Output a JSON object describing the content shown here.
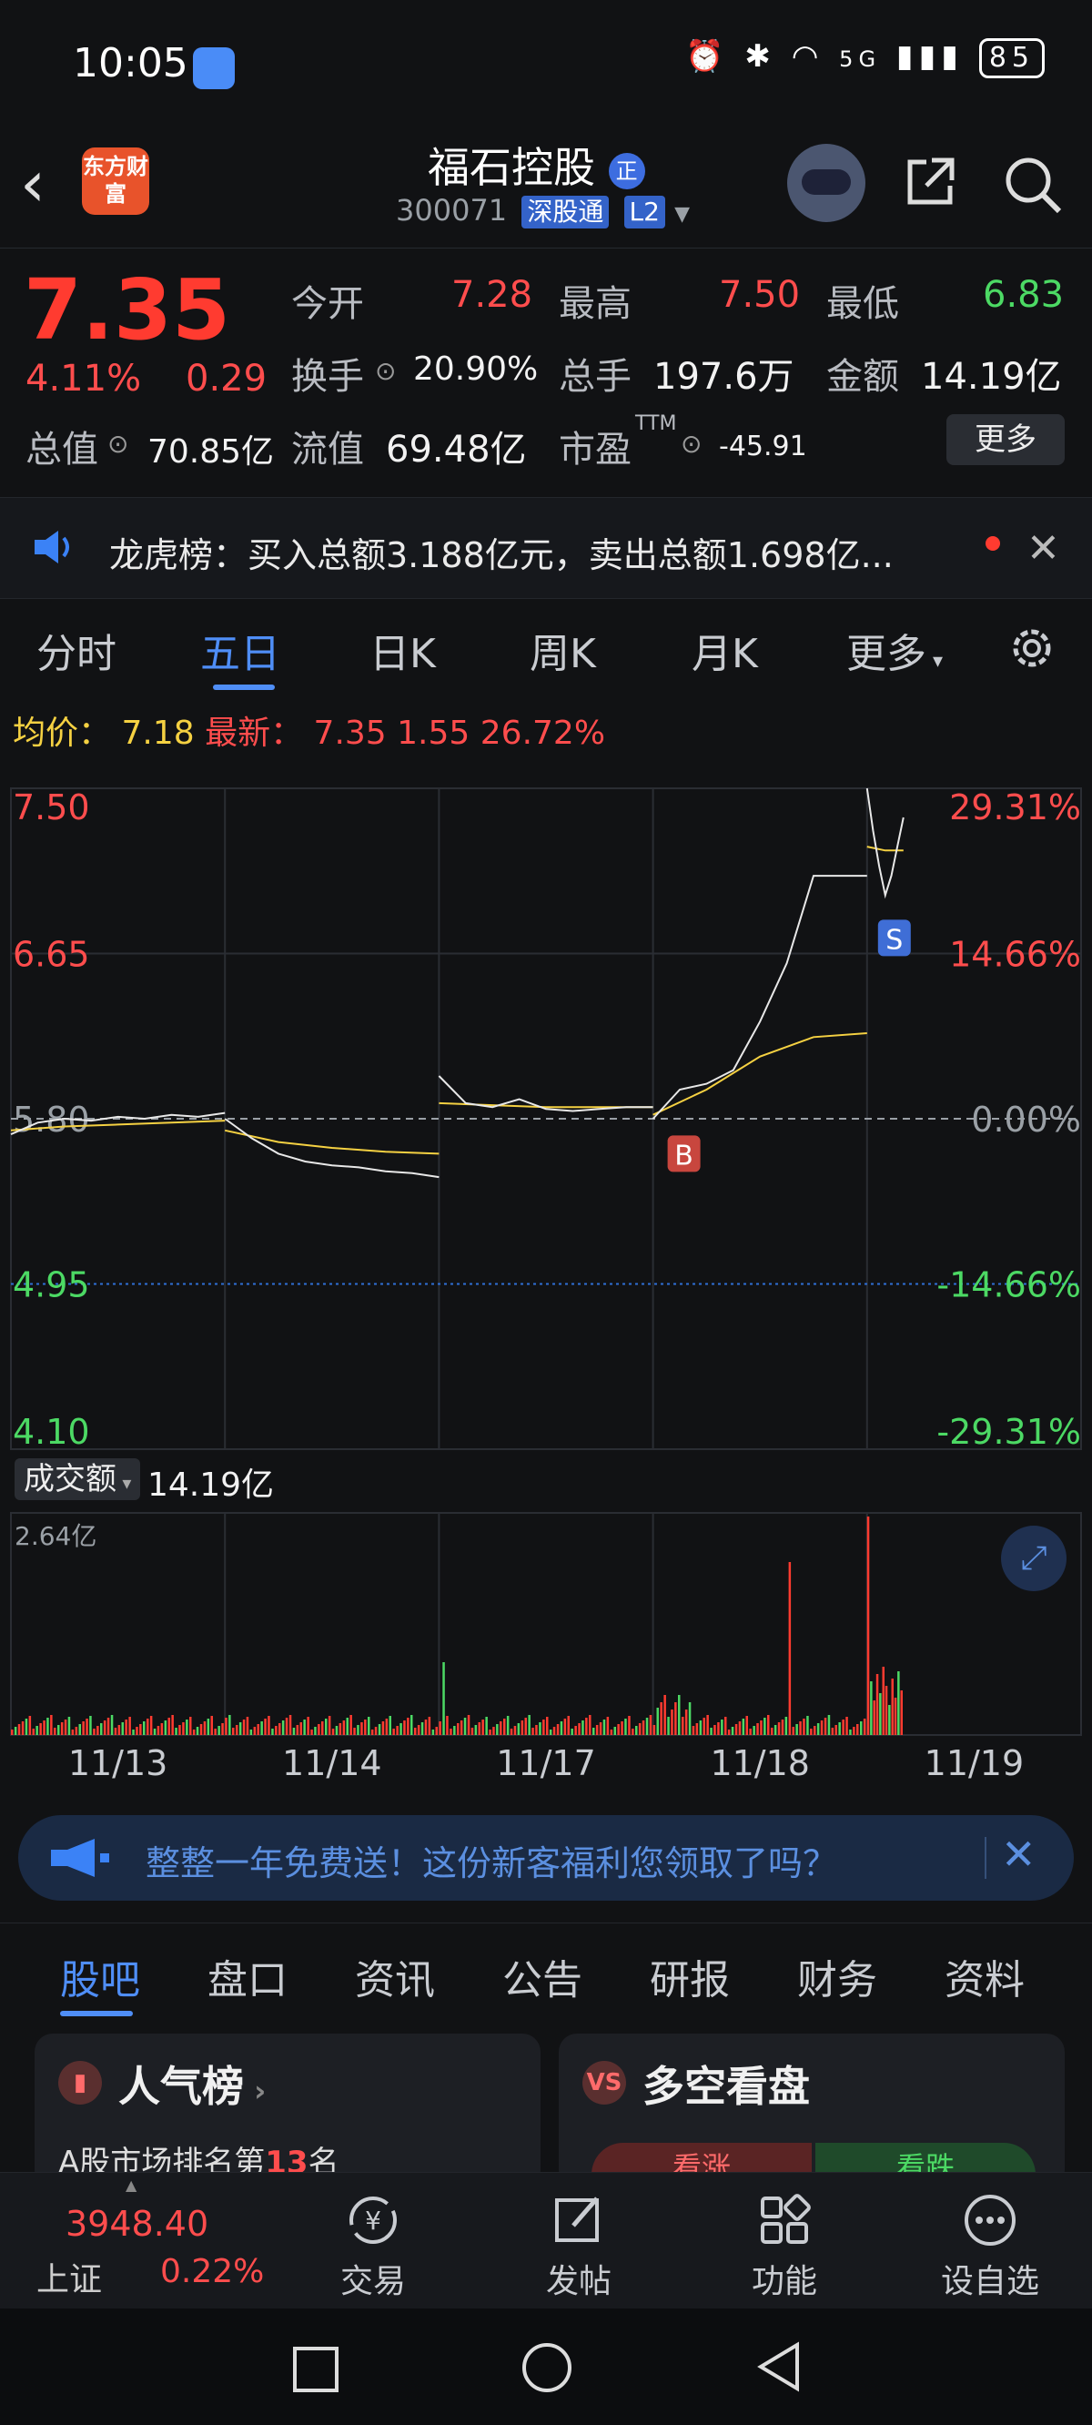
{
  "status_bar": {
    "time": "10:05",
    "network": "5G",
    "battery": "85"
  },
  "header": {
    "app_logo_text": "东方财富",
    "stock_name": "福石控股",
    "badge": "正",
    "code": "300071",
    "tag_connect": "深股通",
    "tag_level": "L2"
  },
  "quote": {
    "price": "7.35",
    "change_pct": "4.11%",
    "change": "0.29",
    "open_label": "今开",
    "open": "7.28",
    "high_label": "最高",
    "high": "7.50",
    "low_label": "最低",
    "low": "6.83",
    "turnover_label": "换手",
    "turnover": "20.90%",
    "volume_label": "总手",
    "volume": "197.6万",
    "amount_label": "金额",
    "amount": "14.19亿",
    "mktcap_label": "总值",
    "mktcap": "70.85亿",
    "float_label": "流值",
    "float_cap": "69.48亿",
    "pe_label": "市盈",
    "pe_sup": "TTM",
    "pe": "-45.91",
    "more_button": "更多"
  },
  "dragon_banner": {
    "text": "龙虎榜：买入总额3.188亿元，卖出总额1.698亿..."
  },
  "chart_tabs": [
    "分时",
    "五日",
    "日K",
    "周K",
    "月K",
    "更多"
  ],
  "chart_tabs_active": 1,
  "info_line": {
    "avg_label": "均价：",
    "avg": "7.18",
    "latest_label": "最新：",
    "latest": "7.35",
    "delta": "1.55",
    "delta_pct": "26.72%"
  },
  "chart_data": {
    "type": "line",
    "x_dates": [
      "11/13",
      "11/14",
      "11/17",
      "11/18",
      "11/19"
    ],
    "y_left_ticks": [
      "7.50",
      "6.65",
      "5.80",
      "4.95",
      "4.10"
    ],
    "y_right_ticks": [
      "29.31%",
      "14.66%",
      "0.00%",
      "-14.66%",
      "-29.31%"
    ],
    "ylim": [
      4.1,
      7.5
    ],
    "baseline": 5.8,
    "price_series": [
      {
        "day": "11/13",
        "values": [
          5.72,
          5.78,
          5.8,
          5.79,
          5.81,
          5.8,
          5.82,
          5.81,
          5.83
        ]
      },
      {
        "day": "11/14",
        "values": [
          5.8,
          5.7,
          5.62,
          5.58,
          5.56,
          5.55,
          5.53,
          5.52,
          5.5
        ]
      },
      {
        "day": "11/17",
        "values": [
          6.02,
          5.88,
          5.86,
          5.9,
          5.85,
          5.84,
          5.85,
          5.86,
          5.86
        ]
      },
      {
        "day": "11/18",
        "values": [
          5.8,
          5.95,
          5.98,
          6.05,
          6.3,
          6.6,
          7.05,
          7.05,
          7.05
        ]
      },
      {
        "day": "11/19",
        "values": [
          7.5,
          7.28,
          7.1,
          6.95,
          7.05,
          7.2,
          7.35
        ]
      }
    ],
    "avg_series": [
      {
        "day": "11/13",
        "values": [
          5.74,
          5.76,
          5.77,
          5.78,
          5.79
        ]
      },
      {
        "day": "11/14",
        "values": [
          5.74,
          5.68,
          5.65,
          5.63,
          5.62
        ]
      },
      {
        "day": "11/17",
        "values": [
          5.88,
          5.87,
          5.86,
          5.86,
          5.86
        ]
      },
      {
        "day": "11/18",
        "values": [
          5.82,
          5.95,
          6.12,
          6.22,
          6.24
        ]
      },
      {
        "day": "11/19",
        "values": [
          7.2,
          7.18,
          7.18
        ]
      }
    ],
    "markers": [
      {
        "label": "B",
        "day": "11/18"
      },
      {
        "label": "S",
        "day": "11/19"
      }
    ],
    "volume": {
      "label": "成交额",
      "value": "14.19亿",
      "max_label": "2.64亿"
    }
  },
  "promo": {
    "text": "整整一年免费送！这份新客福利您领取了吗？"
  },
  "bottom_tabs": [
    "股吧",
    "盘口",
    "资讯",
    "公告",
    "研报",
    "财务",
    "资料"
  ],
  "bottom_tabs_active": 0,
  "cards": {
    "popularity": {
      "title": "人气榜",
      "line_prefix": "A股市场排名第",
      "rank": "13",
      "line_suffix": "名"
    },
    "longshort": {
      "title": "多空看盘",
      "icon": "VS",
      "bull": "看涨",
      "bear": "看跌"
    }
  },
  "footer": {
    "index_value": "3948.40",
    "index_name": "上证",
    "index_pct": "0.22%",
    "items": [
      "交易",
      "发帖",
      "功能",
      "设自选"
    ]
  }
}
